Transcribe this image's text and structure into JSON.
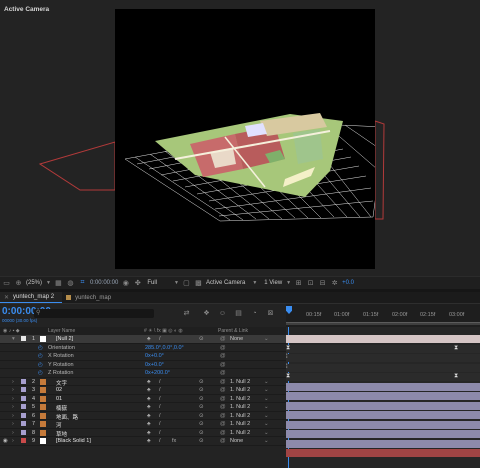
{
  "viewer": {
    "camera_label": "Active Camera"
  },
  "viewer_controls": {
    "zoom": "(25%)",
    "timecode": "0:00:00:00",
    "resolution": "Full",
    "view": "Active Camera",
    "views": "1 View",
    "exposure": "+0.0"
  },
  "tabs": [
    {
      "label": "yuntech_map 2",
      "active": true
    },
    {
      "label": "yuntech_map",
      "active": false
    }
  ],
  "timeline": {
    "timecode": "0:00:00:00",
    "fps": "00000 (30.00 fps)",
    "search_placeholder": "",
    "ticks": [
      "00:15f",
      "01:00f",
      "01:15f",
      "02:00f",
      "02:15f",
      "03:00f"
    ],
    "columns": {
      "source": "Layer Name",
      "switches": "# ☀ \\ fx ▣ ◎ ◐ ◍",
      "parent": "Parent & Link"
    }
  },
  "layers": [
    {
      "type": "layer",
      "num": "1",
      "name": "[Null 2]",
      "label_color": "#e8e8e8",
      "parent": "None",
      "selected": true,
      "bar": "#d6c6c6"
    },
    {
      "type": "prop",
      "name": "Orientation",
      "value": "285.0°,0.0°,0.0°",
      "key": "⧗"
    },
    {
      "type": "prop",
      "name": "X Rotation",
      "value": "0x+0.0°"
    },
    {
      "type": "prop",
      "name": "Y Rotation",
      "value": "0x+0.0°"
    },
    {
      "type": "prop",
      "name": "Z Rotation",
      "value": "0x+200.0°",
      "key": "⧗"
    },
    {
      "type": "layer",
      "num": "2",
      "name": "文字",
      "label_color": "#a79fcf",
      "parent": "1. Null 2",
      "bar": "#8d8aab"
    },
    {
      "type": "layer",
      "num": "3",
      "name": "02",
      "label_color": "#a79fcf",
      "parent": "1. Null 2",
      "bar": "#8d8aab"
    },
    {
      "type": "layer",
      "num": "4",
      "name": "01",
      "label_color": "#a79fcf",
      "parent": "1. Null 2",
      "bar": "#8d8aab"
    },
    {
      "type": "layer",
      "num": "5",
      "name": "楠嶽",
      "label_color": "#a79fcf",
      "parent": "1. Null 2",
      "bar": "#8d8aab"
    },
    {
      "type": "layer",
      "num": "6",
      "name": "地面、路",
      "label_color": "#a79fcf",
      "parent": "1. Null 2",
      "bar": "#8d8aab"
    },
    {
      "type": "layer",
      "num": "7",
      "name": "河",
      "label_color": "#a79fcf",
      "parent": "1. Null 2",
      "bar": "#8d8aab"
    },
    {
      "type": "layer",
      "num": "8",
      "name": "草地",
      "label_color": "#a79fcf",
      "parent": "1. Null 2",
      "bar": "#8d8aab"
    },
    {
      "type": "layer",
      "num": "9",
      "name": "[Black Solid 1]",
      "label_color": "#c94a4a",
      "parent": "None",
      "bar": "#a04444"
    }
  ],
  "colors": {
    "accent": "#3a8df0",
    "grid": "#ffffff",
    "map_green": "#a7c77a",
    "map_red": "#c76b6b",
    "comp_bg": "#000000"
  }
}
